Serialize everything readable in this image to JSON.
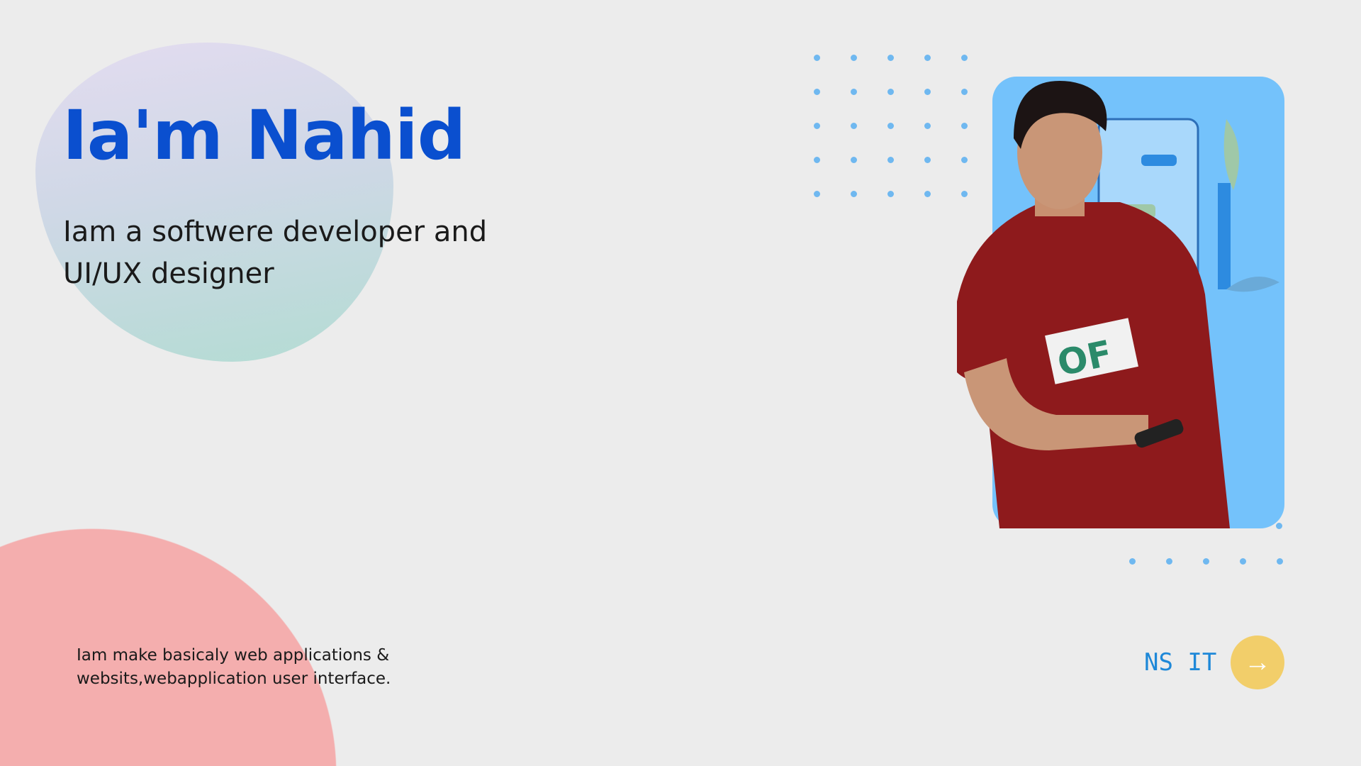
{
  "hero": {
    "title": "Ia'm Nahid",
    "subtitle": "Iam a softwere developer and UI/UX designer",
    "description": "Iam make basicaly web applications & websits,webapplication user interface."
  },
  "footer": {
    "brand": "NS IT",
    "next_icon": "arrow-right-icon"
  },
  "colors": {
    "accent": "#0a4fcf",
    "brand": "#1e88d8",
    "button": "#f2ce6a",
    "pink": "#f4aeae",
    "card": "#74c2fb"
  }
}
